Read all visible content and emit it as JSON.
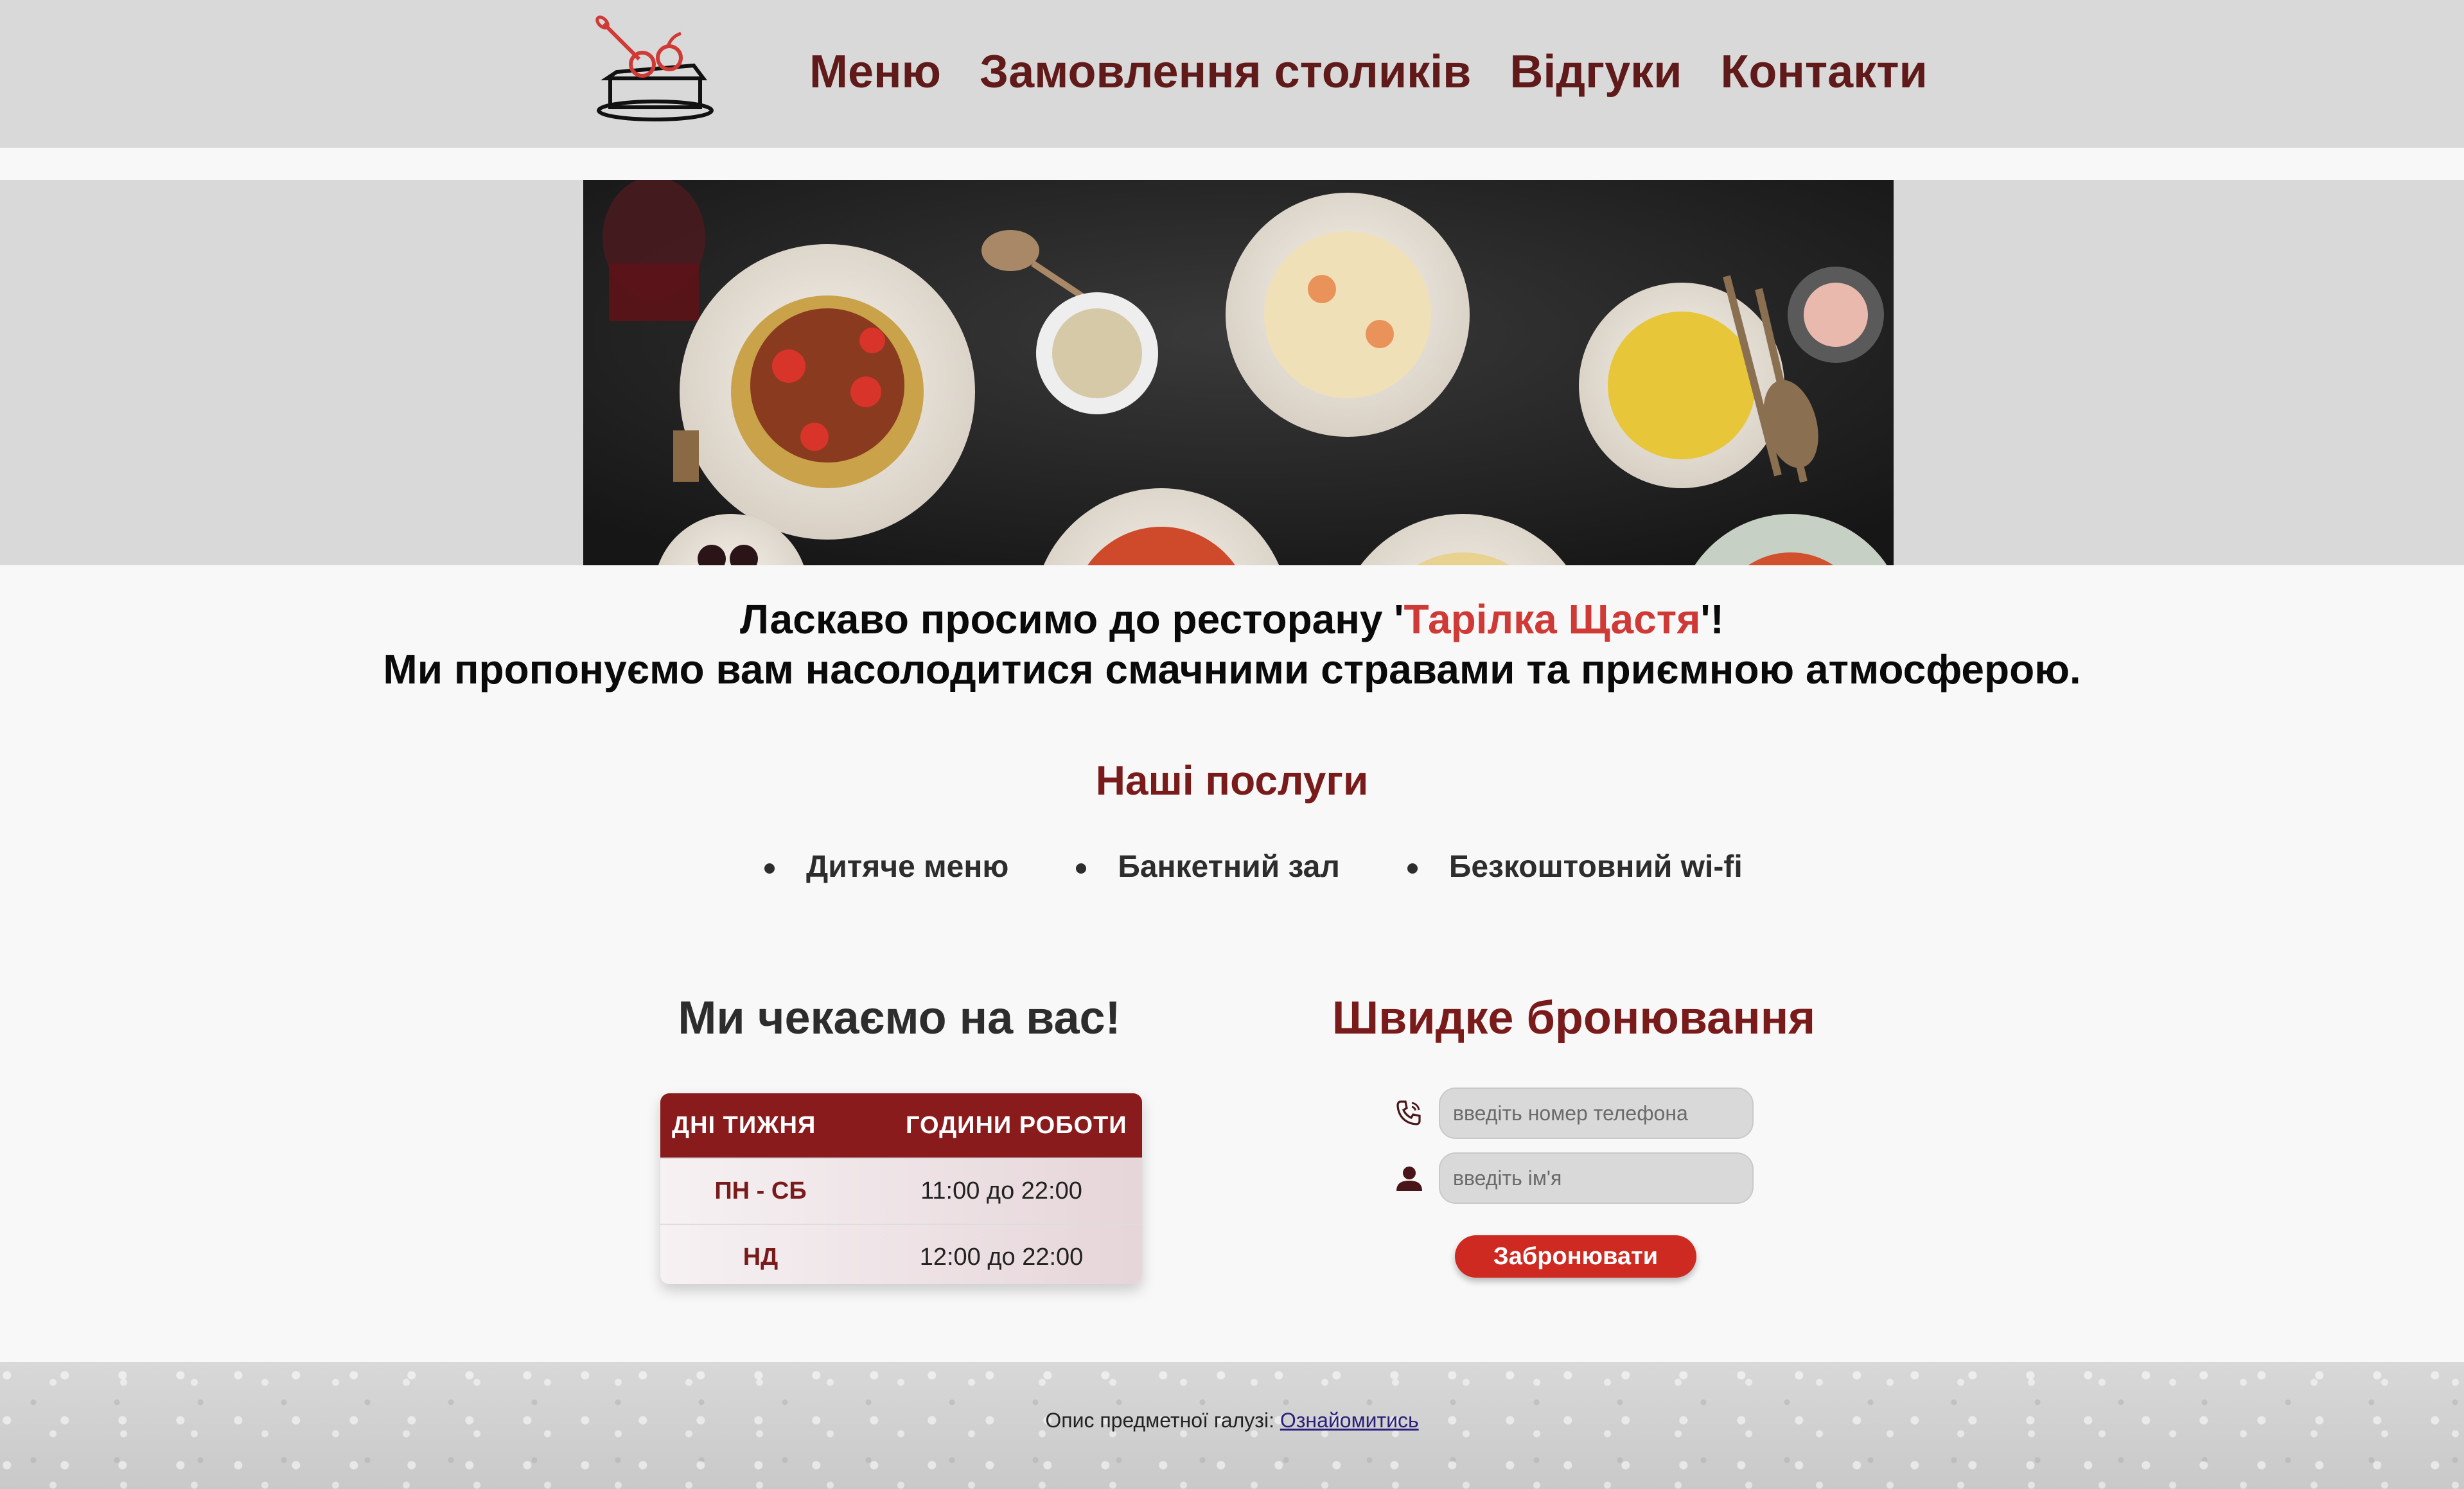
{
  "header": {
    "nav": [
      "Меню",
      "Замовлення столиків",
      "Відгуки",
      "Контакти"
    ]
  },
  "welcome": {
    "line1_prefix": "Ласкаво просимо до ресторану '",
    "brand": "Тарілка Щастя",
    "line1_suffix": "'!",
    "line2": "Ми пропонуємо вам насолодитися смачними стравами та приємною атмосферою."
  },
  "services": {
    "title": "Наші послуги",
    "items": [
      "Дитяче меню",
      "Банкетний зал",
      "Безкоштовний wi-fi"
    ]
  },
  "schedule": {
    "title": "Ми чекаємо на вас!",
    "headers": [
      "ДНІ ТИЖНЯ",
      "ГОДИНИ РОБОТИ"
    ],
    "rows": [
      {
        "day": "ПН - СБ",
        "hours": "11:00 до 22:00"
      },
      {
        "day": "НД",
        "hours": "12:00 до 22:00"
      }
    ]
  },
  "booking": {
    "title": "Швидке бронювання",
    "phone_placeholder": "введіть номер телефона",
    "name_placeholder": "введіть ім'я",
    "button": "Забронювати"
  },
  "footer": {
    "text": "Опис предметної галузі: ",
    "link": "Ознайомитись"
  },
  "colors": {
    "nav": "#611a1a",
    "brand": "#cf3a36",
    "accent": "#7a1b1b",
    "button": "#cf2a22"
  }
}
